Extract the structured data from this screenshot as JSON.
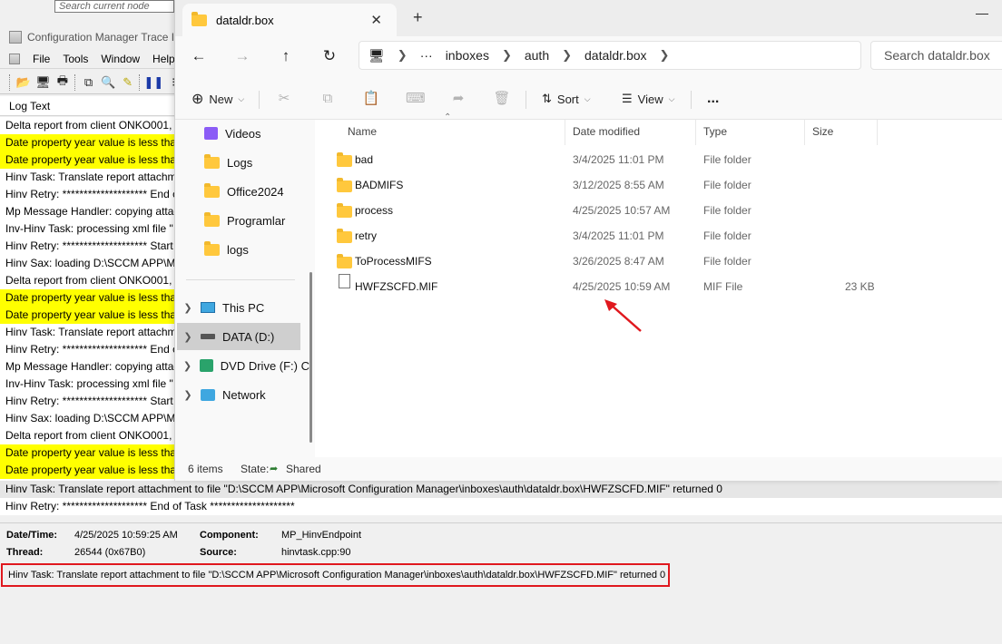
{
  "trace": {
    "search_placeholder": "Search current node",
    "title": "Configuration Manager Trace I",
    "menu": [
      "File",
      "Tools",
      "Window",
      "Help"
    ],
    "log_header": "Log Text",
    "rows": [
      {
        "text": "Delta report from client ONKO001, a",
        "highlight": false
      },
      {
        "text": "Date property year value is less thar",
        "highlight": true
      },
      {
        "text": "Date property year value is less thar",
        "highlight": true
      },
      {
        "text": "Hinv Task: Translate report attachm",
        "highlight": false
      },
      {
        "text": "Hinv Retry: ******************** End c",
        "highlight": false
      },
      {
        "text": "Mp Message Handler: copying attac",
        "highlight": false
      },
      {
        "text": "Inv-Hinv Task: processing xml file \"",
        "highlight": false
      },
      {
        "text": "Hinv Retry: ******************** Start",
        "highlight": false
      },
      {
        "text": "Hinv Sax: loading D:\\SCCM APP\\Mi",
        "highlight": false
      },
      {
        "text": "Delta report from client ONKO001, a",
        "highlight": false
      },
      {
        "text": "Date property year value is less thar",
        "highlight": true
      },
      {
        "text": "Date property year value is less thar",
        "highlight": true
      },
      {
        "text": "Hinv Task: Translate report attachm",
        "highlight": false
      },
      {
        "text": "Hinv Retry: ******************** End c",
        "highlight": false
      },
      {
        "text": "Mp Message Handler: copying attac",
        "highlight": false
      },
      {
        "text": "Inv-Hinv Task: processing xml file \"",
        "highlight": false
      },
      {
        "text": "Hinv Retry: ******************** Start",
        "highlight": false
      },
      {
        "text": "Hinv Sax: loading D:\\SCCM APP\\Mi",
        "highlight": false
      },
      {
        "text": "Delta report from client ONKO001, a",
        "highlight": false
      },
      {
        "text": "Date property year value is less thar",
        "highlight": true
      },
      {
        "text": "Date property year value is less thar",
        "highlight": true
      }
    ],
    "selected_row": "Hinv Task: Translate report attachment to file \"D:\\SCCM APP\\Microsoft Configuration Manager\\inboxes\\auth\\dataldr.box\\HWFZSCFD.MIF\" returned 0",
    "next_row": "Hinv Retry: ******************** End of Task ********************",
    "details": {
      "datetime_label": "Date/Time:",
      "datetime_value": "4/25/2025 10:59:25 AM",
      "component_label": "Component:",
      "component_value": "MP_HinvEndpoint",
      "thread_label": "Thread:",
      "thread_value": "26544 (0x67B0)",
      "source_label": "Source:",
      "source_value": "hinvtask.cpp:90",
      "message": "Hinv Task: Translate report attachment to file \"D:\\SCCM APP\\Microsoft Configuration Manager\\inboxes\\auth\\dataldr.box\\HWFZSCFD.MIF\" returned 0"
    },
    "highlight_color": "#ffff00",
    "annotation_color": "#e0181e"
  },
  "explorer": {
    "tab_title": "dataldr.box",
    "breadcrumb": [
      "inboxes",
      "auth",
      "dataldr.box"
    ],
    "search_placeholder": "Search dataldr.box",
    "commands": {
      "new": "New",
      "sort": "Sort",
      "view": "View",
      "more": "..."
    },
    "quick_access": [
      "Videos",
      "Logs",
      "Office2024",
      "Programlar",
      "logs"
    ],
    "drives": [
      "This PC",
      "DATA (D:)",
      "DVD Drive (F:) C",
      "Network"
    ],
    "columns": {
      "name": "Name",
      "date": "Date modified",
      "type": "Type",
      "size": "Size"
    },
    "files": [
      {
        "name": "bad",
        "date": "3/4/2025 11:01 PM",
        "type": "File folder",
        "size": "",
        "icon": "folder-icon"
      },
      {
        "name": "BADMIFS",
        "date": "3/12/2025 8:55 AM",
        "type": "File folder",
        "size": "",
        "icon": "folder-icon"
      },
      {
        "name": "process",
        "date": "4/25/2025 10:57 AM",
        "type": "File folder",
        "size": "",
        "icon": "folder-icon"
      },
      {
        "name": "retry",
        "date": "3/4/2025 11:01 PM",
        "type": "File folder",
        "size": "",
        "icon": "folder-icon"
      },
      {
        "name": "ToProcessMIFS",
        "date": "3/26/2025 8:47 AM",
        "type": "File folder",
        "size": "",
        "icon": "folder-icon"
      },
      {
        "name": "HWFZSCFD.MIF",
        "date": "4/25/2025 10:59 AM",
        "type": "MIF File",
        "size": "23 KB",
        "icon": "file-icon"
      }
    ],
    "status": {
      "items": "6 items",
      "state_label": "State:",
      "state_value": "Shared"
    },
    "folder_color": "#ffc83d"
  }
}
